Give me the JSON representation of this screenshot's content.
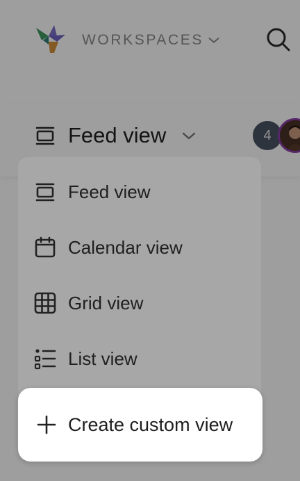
{
  "header": {
    "workspace_label": "WORKSPACES",
    "logo_icon": "app-logo",
    "search_icon": "search-icon"
  },
  "view_bar": {
    "current_view": "Feed view",
    "current_view_icon": "feed-view-icon",
    "collaborator_count": "4"
  },
  "view_menu": {
    "items": [
      {
        "label": "Feed view",
        "icon": "feed-view-icon"
      },
      {
        "label": "Calendar view",
        "icon": "calendar-icon"
      },
      {
        "label": "Grid view",
        "icon": "grid-icon"
      },
      {
        "label": "List view",
        "icon": "list-icon"
      }
    ],
    "create_label": "Create custom view",
    "create_icon": "plus-icon"
  },
  "colors": {
    "avatar_count_bg": "#4b5564",
    "avatar_ring": "#8b3fa8",
    "overlay": "rgba(0,0,0,0.38)"
  }
}
